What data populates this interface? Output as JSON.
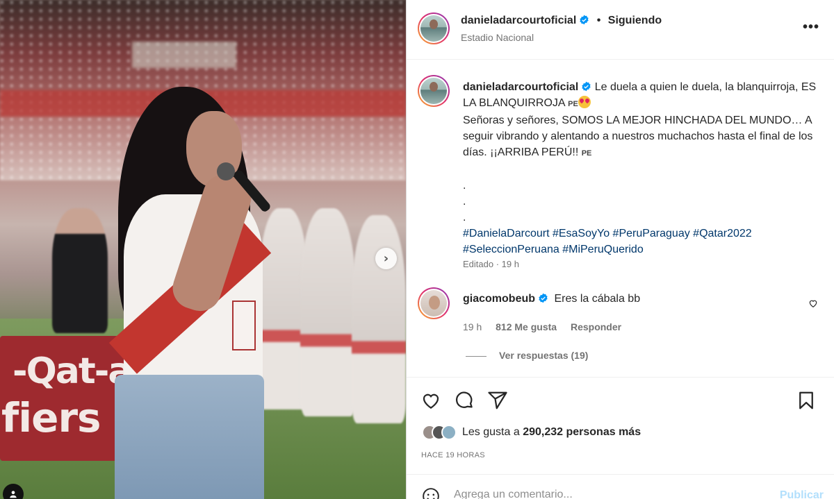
{
  "post": {
    "author": "danieladarcourtoficial",
    "follow_status": "Siguiendo",
    "location": "Estadio Nacional",
    "caption_lines": {
      "l1": "Le duela a quien le duela, la blanquirroja,",
      "l2": "ES LA BLANQUIRROJA",
      "l3": "Señoras y señores, SOMOS LA MEJOR HINCHADA DEL MUNDO… A seguir vibrando y alentando a nuestros muchachos hasta el final de los días. ¡¡ARRIBA PERÚ!!",
      "flag": "PE",
      "dot": "."
    },
    "hashtags": "#DanielaDarcourt #EsaSoyYo #PeruParaguay #Qatar2022 #SeleccionPeruana #MiPeruQuerido",
    "edited": "Editado · 19 h"
  },
  "comment": {
    "author": "giacomobeub",
    "text": "Eres la cábala bb",
    "time": "19 h",
    "likes": "812 Me gusta",
    "reply": "Responder",
    "view_replies": "Ver respuestas (19)"
  },
  "likes": {
    "prefix": "Les gusta a",
    "count": "290,232",
    "suffix": "personas más"
  },
  "time_ago": "HACE 19 HORAS",
  "add_comment": {
    "placeholder": "Agrega un comentario...",
    "publish": "Publicar"
  },
  "photo": {
    "board_text1": "-Qat-a",
    "board_text2": "fiers"
  },
  "colors": {
    "verified": "#0095f6",
    "hashtag": "#00376b",
    "publish": "#b2dffc"
  },
  "icons": [
    "verified-icon",
    "more-icon",
    "heart-icon",
    "comment-icon",
    "share-icon",
    "bookmark-icon",
    "emoji-icon",
    "chevron-right-icon",
    "user-tag-icon"
  ]
}
